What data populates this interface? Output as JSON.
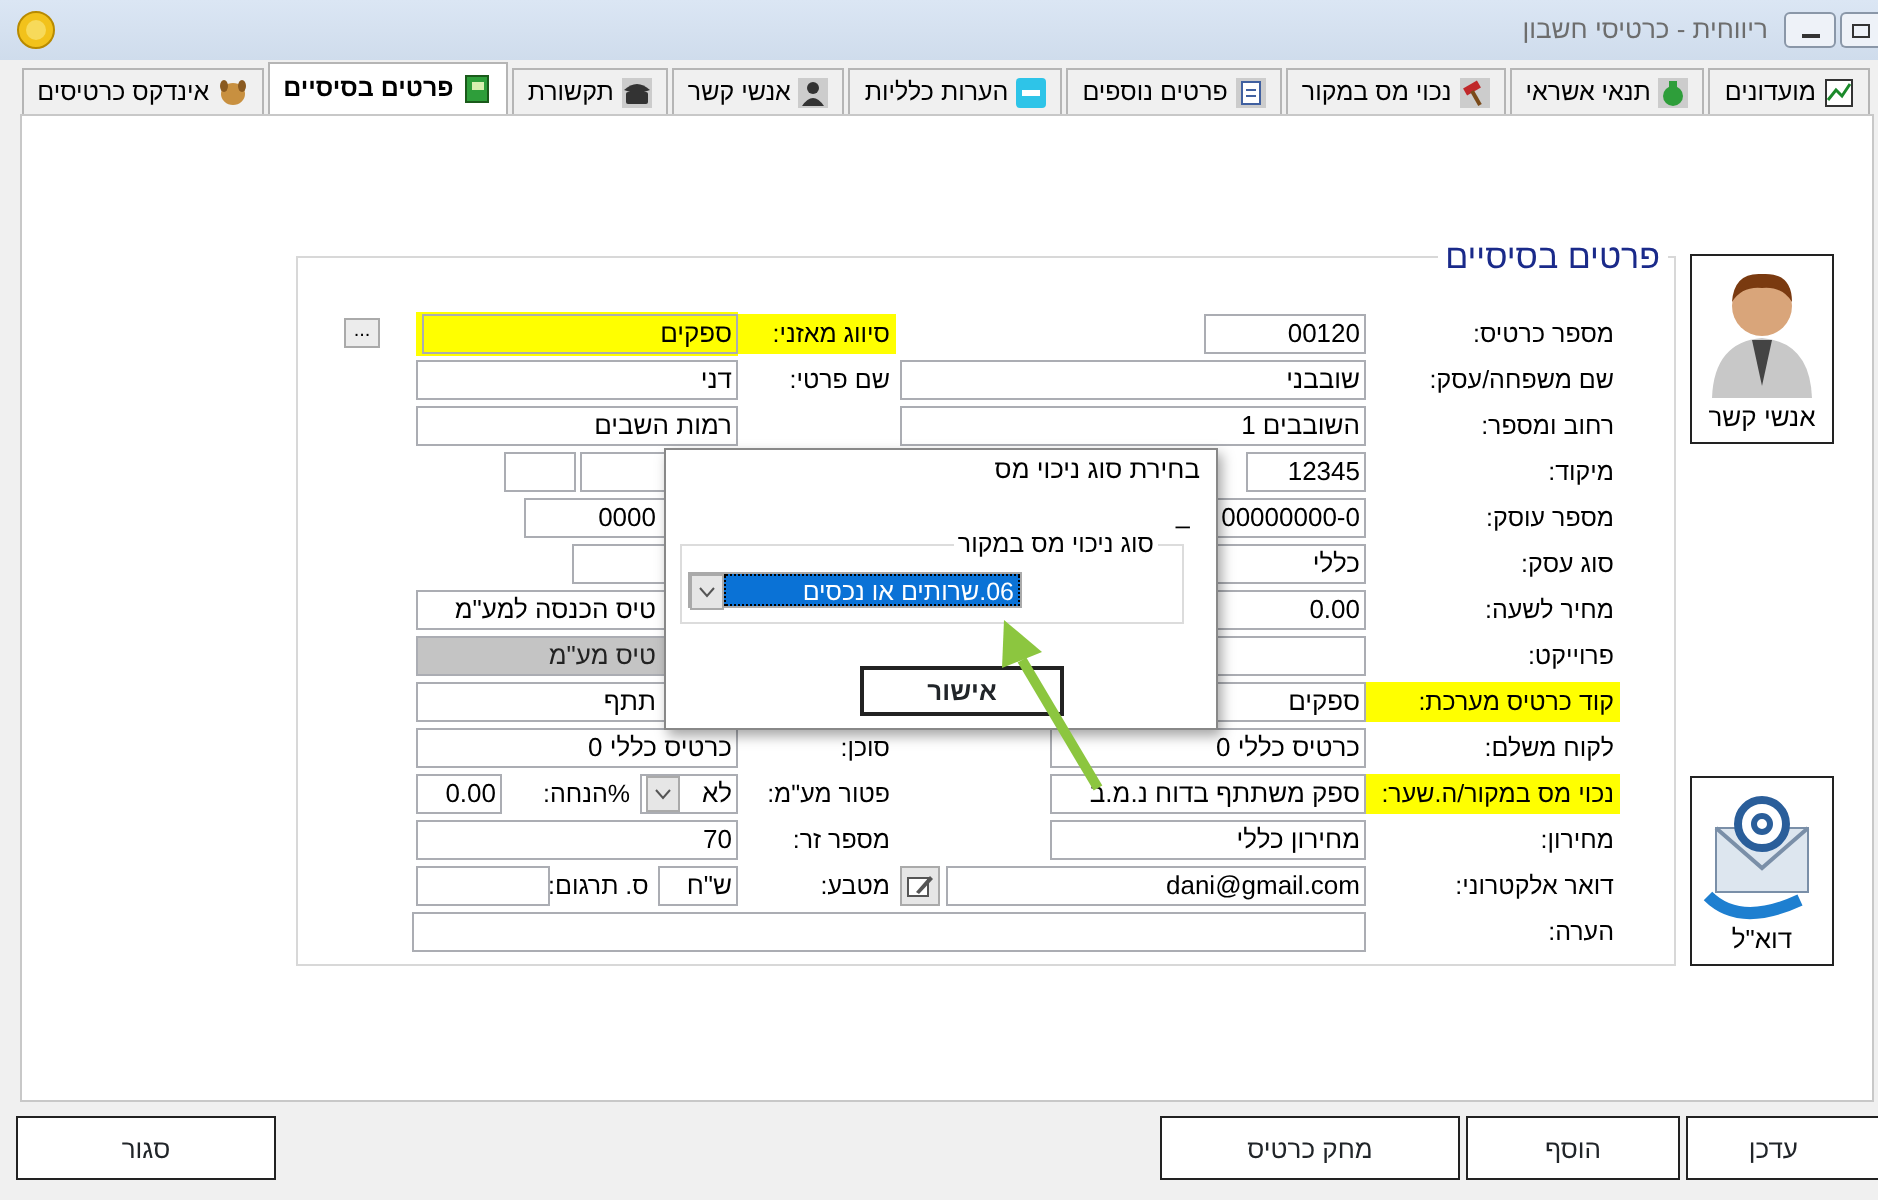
{
  "window": {
    "title": "ריווחית - כרטיסי חשבון"
  },
  "tabs": [
    {
      "label": "מועדונים",
      "selected": false
    },
    {
      "label": "תנאי אשראי",
      "selected": false
    },
    {
      "label": "נכוי מס במקור",
      "selected": false
    },
    {
      "label": "פרטים נוספים",
      "selected": false
    },
    {
      "label": "הערות כלליות",
      "selected": false
    },
    {
      "label": "אנשי קשר",
      "selected": false
    },
    {
      "label": "תקשורת",
      "selected": false
    },
    {
      "label": "פרטים בסיסיים",
      "selected": true
    },
    {
      "label": "אינדקס כרטיסים",
      "selected": false
    }
  ],
  "form": {
    "legend": "פרטים בסיסיים",
    "right_fields": [
      {
        "label": "מספר כרטיס:",
        "value": "00120",
        "highlighted": false
      },
      {
        "label": "שם משפחה/עסק:",
        "value": "שובבני",
        "highlighted": false
      },
      {
        "label": "רחוב ומספר:",
        "value": "השובבים 1",
        "highlighted": false
      },
      {
        "label": "מיקוד:",
        "value": "12345",
        "highlighted": false
      },
      {
        "label": "מספר עוסק:",
        "value": "00000000-0",
        "highlighted": false
      },
      {
        "label": "סוג עסק:",
        "value": "כללי",
        "highlighted": false
      },
      {
        "label": "מחיר לשעה:",
        "value": "0.00",
        "highlighted": false
      },
      {
        "label": "פרוייקט:",
        "highlighted": false
      },
      {
        "label": "קוד כרטיס מערכת:",
        "value": "ספקים",
        "highlighted": true
      },
      {
        "label": "לקוח משלם:",
        "value": "כרטיס כללי 0",
        "highlighted": false
      },
      {
        "label": "נכוי מס במקור/ה.שער:",
        "value": "ספק משתתף בדוח נ.מ.ב",
        "highlighted": true
      },
      {
        "label": "מחירון:",
        "value": "מחירון כללי",
        "highlighted": false
      },
      {
        "label": "דואר אלקטרוני:",
        "value": "dani@gmail.com",
        "highlighted": false,
        "kind": "email"
      },
      {
        "label": "הערה:",
        "highlighted": false,
        "kind": "wide"
      }
    ],
    "left_fields": [
      {
        "kind": "browse",
        "label": "סיווג מאזני:",
        "value": "ספקים",
        "button": "...",
        "highlighted": true,
        "disabled": false
      },
      {
        "kind": "text",
        "label": "שם פרטי:",
        "value": "דני",
        "highlighted": false,
        "disabled": false
      },
      {
        "kind": "text",
        "value": "רמות השבים",
        "highlighted": false,
        "disabled": false
      },
      {
        "kind": "pair",
        "highlighted": false,
        "disabled": false
      },
      {
        "kind": "covered",
        "value": "0000",
        "highlighted": false,
        "disabled": false
      },
      {
        "kind": "covered",
        "highlighted": false,
        "disabled": false
      },
      {
        "kind": "covered",
        "value": "טיס הכנסה למע\"מ",
        "highlighted": false,
        "disabled": false
      },
      {
        "kind": "covered",
        "value": "טיס מע\"מ",
        "highlighted": false,
        "disabled": true
      },
      {
        "kind": "covered",
        "value": "תתף",
        "highlighted": false,
        "disabled": false
      },
      {
        "kind": "text",
        "label": "סוכן:",
        "value": "כרטיס כללי 0",
        "highlighted": false,
        "disabled": false
      },
      {
        "kind": "combo",
        "label": "פטור מע\"מ:",
        "value": "לא",
        "extra_label": "%הנחה:",
        "extra_value": "0.00",
        "highlighted": false,
        "disabled": false
      },
      {
        "kind": "text",
        "label": "מספר זר:",
        "value": "70",
        "highlighted": false,
        "disabled": false
      },
      {
        "kind": "currency",
        "label": "מטבע:",
        "value": "ש\"ח",
        "extra_label": "ס. תרגום:",
        "highlighted": false,
        "disabled": false
      }
    ]
  },
  "side_buttons": [
    {
      "label": "אנשי קשר",
      "kind": "contacts"
    },
    {
      "label": "דוא\"ל",
      "kind": "email"
    }
  ],
  "dialog": {
    "title": "בחירת סוג ניכוי מס",
    "dash": "–",
    "group": "סוג ניכוי מס במקור",
    "selection": "06.שרותים או נכסים",
    "ok": "אישור"
  },
  "buttons": [
    "עדכן",
    "הוסף",
    "מחק כרטיס",
    "סגור"
  ]
}
